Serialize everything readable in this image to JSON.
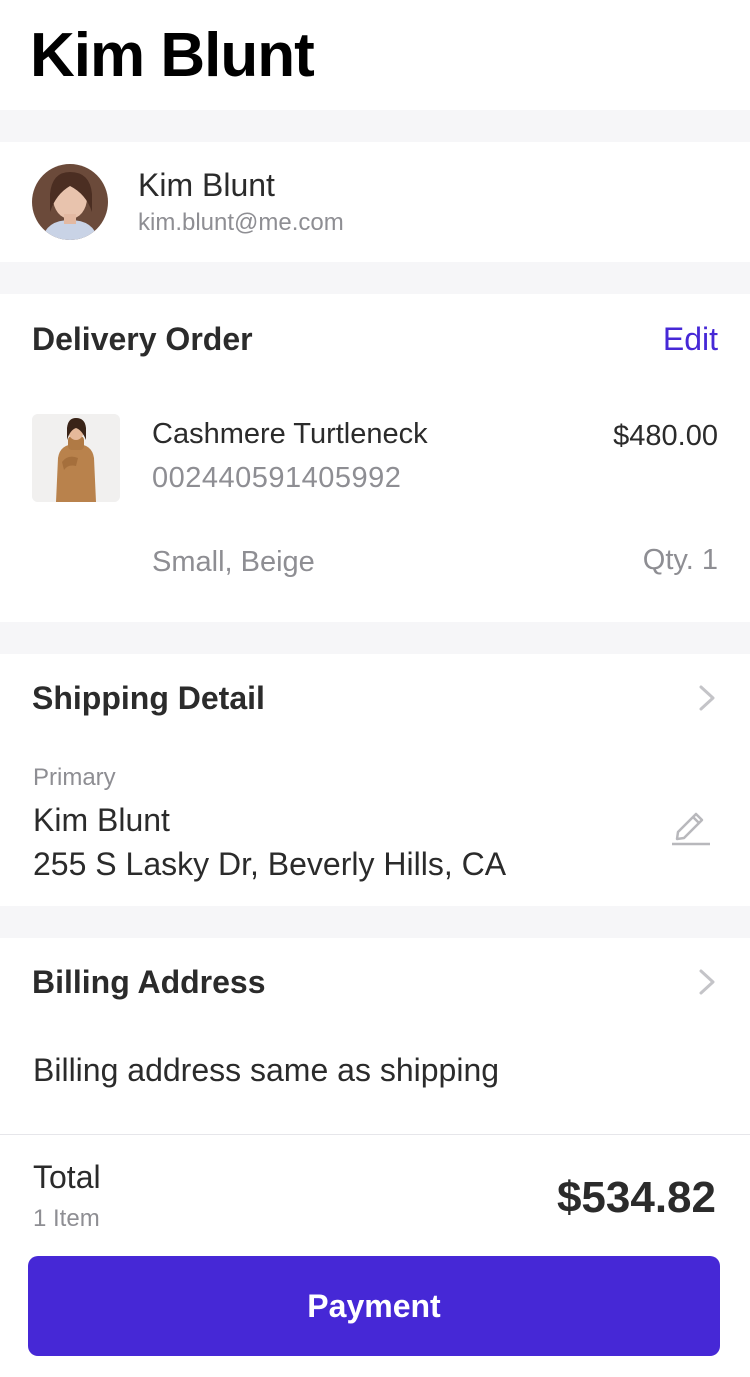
{
  "page": {
    "title": "Kim Blunt"
  },
  "profile": {
    "name": "Kim Blunt",
    "email": "kim.blunt@me.com",
    "avatar_icon": "user-avatar"
  },
  "order": {
    "title": "Delivery Order",
    "edit_label": "Edit",
    "item": {
      "name": "Cashmere Turtleneck",
      "sku": "002440591405992",
      "price": "$480.00",
      "variant": "Small, Beige",
      "qty": "Qty. 1"
    }
  },
  "shipping": {
    "title": "Shipping Detail",
    "label": "Primary",
    "name": "Kim Blunt",
    "address": "255 S Lasky Dr, Beverly Hills, CA"
  },
  "billing": {
    "title": "Billing Address",
    "text": "Billing address same as shipping"
  },
  "summary": {
    "total_label": "Total",
    "item_count": "1 Item",
    "amount": "$534.82",
    "pay_label": "Payment"
  },
  "colors": {
    "accent": "#4628d6",
    "muted": "#8e8e93",
    "section_gap": "#f6f6f8"
  }
}
